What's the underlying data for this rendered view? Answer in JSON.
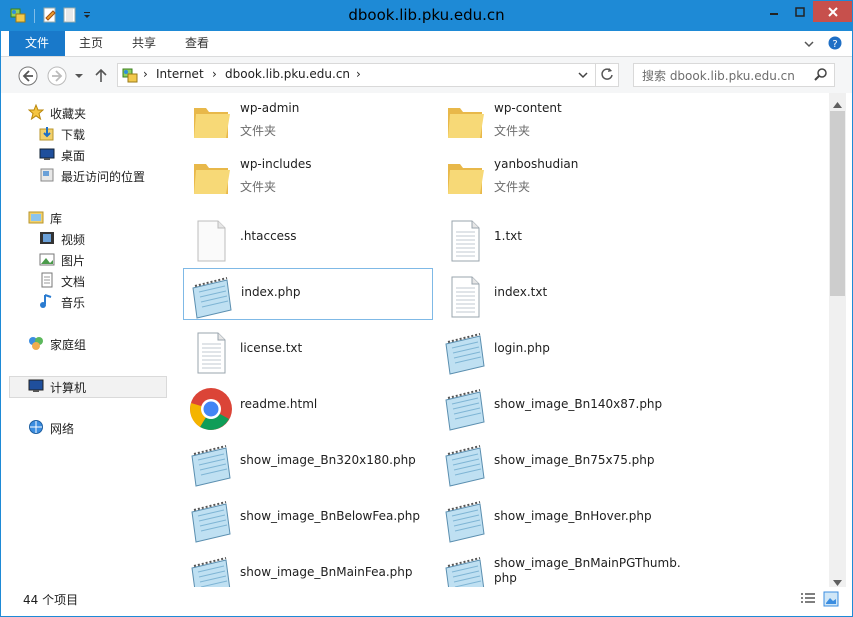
{
  "window": {
    "title": "dbook.lib.pku.edu.cn"
  },
  "ribbon": {
    "file_tab": "文件",
    "tabs": [
      "主页",
      "共享",
      "查看"
    ]
  },
  "address": {
    "segments": [
      "Internet",
      "dbook.lib.pku.edu.cn"
    ]
  },
  "search": {
    "placeholder": "搜索 dbook.lib.pku.edu.cn"
  },
  "nav": {
    "favorites": {
      "label": "收藏夹",
      "items": [
        "下载",
        "桌面",
        "最近访问的位置"
      ]
    },
    "libraries": {
      "label": "库",
      "items": [
        "视频",
        "图片",
        "文档",
        "音乐"
      ]
    },
    "homegroup": "家庭组",
    "computer": "计算机",
    "network": "网络"
  },
  "files": [
    {
      "name": "wp-admin",
      "type": "文件夹",
      "icon": "folder-icon"
    },
    {
      "name": "wp-content",
      "type": "文件夹",
      "icon": "folder-icon"
    },
    {
      "name": "wp-includes",
      "type": "文件夹",
      "icon": "folder-icon"
    },
    {
      "name": "yanboshudian",
      "type": "文件夹",
      "icon": "folder-icon"
    },
    {
      "name": ".htaccess",
      "icon": "blank-file-icon"
    },
    {
      "name": "1.txt",
      "icon": "text-file-icon"
    },
    {
      "name": "index.php",
      "icon": "notepad-icon",
      "selected": true
    },
    {
      "name": "index.txt",
      "icon": "text-file-icon"
    },
    {
      "name": "license.txt",
      "icon": "text-file-icon"
    },
    {
      "name": "login.php",
      "icon": "notepad-icon"
    },
    {
      "name": "readme.html",
      "icon": "chrome-icon"
    },
    {
      "name": "show_image_Bn140x87.php",
      "icon": "notepad-icon"
    },
    {
      "name": "show_image_Bn320x180.php",
      "icon": "notepad-icon"
    },
    {
      "name": "show_image_Bn75x75.php",
      "icon": "notepad-icon"
    },
    {
      "name": "show_image_BnBelowFea.php",
      "icon": "notepad-icon"
    },
    {
      "name": "show_image_BnHover.php",
      "icon": "notepad-icon"
    },
    {
      "name": "show_image_BnMainFea.php",
      "icon": "notepad-icon"
    },
    {
      "name": "show_image_BnMainPGThumb.php",
      "icon": "notepad-icon"
    }
  ],
  "status": {
    "count": "44 个项目"
  },
  "colors": {
    "accent": "#1e8ad6",
    "file_tab": "#1979ca",
    "close": "#c7504c",
    "selection_border": "#7fb9e6"
  }
}
